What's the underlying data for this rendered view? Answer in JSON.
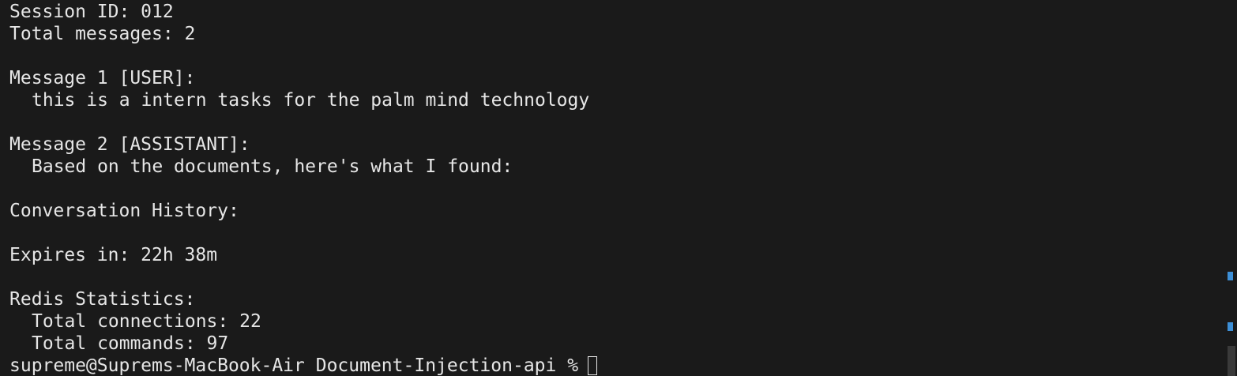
{
  "terminal": {
    "lines": [
      "Session ID: 012",
      "Total messages: 2",
      "",
      "Message 1 [USER]:",
      "this is a intern tasks for the palm mind technology",
      "",
      "Message 2 [ASSISTANT]:",
      "Based on the documents, here's what I found:",
      "",
      "Conversation History:",
      "",
      "Expires in: 22h 38m",
      "",
      "Redis Statistics:",
      "Total connections: 22",
      "Total commands: 97"
    ],
    "prompt": "supreme@Suprems-MacBook-Air Document-Injection-api %"
  },
  "colors": {
    "background": "#1a1a1a",
    "text": "#e6e6e6",
    "scroll_marker": "#3d8fd6"
  }
}
